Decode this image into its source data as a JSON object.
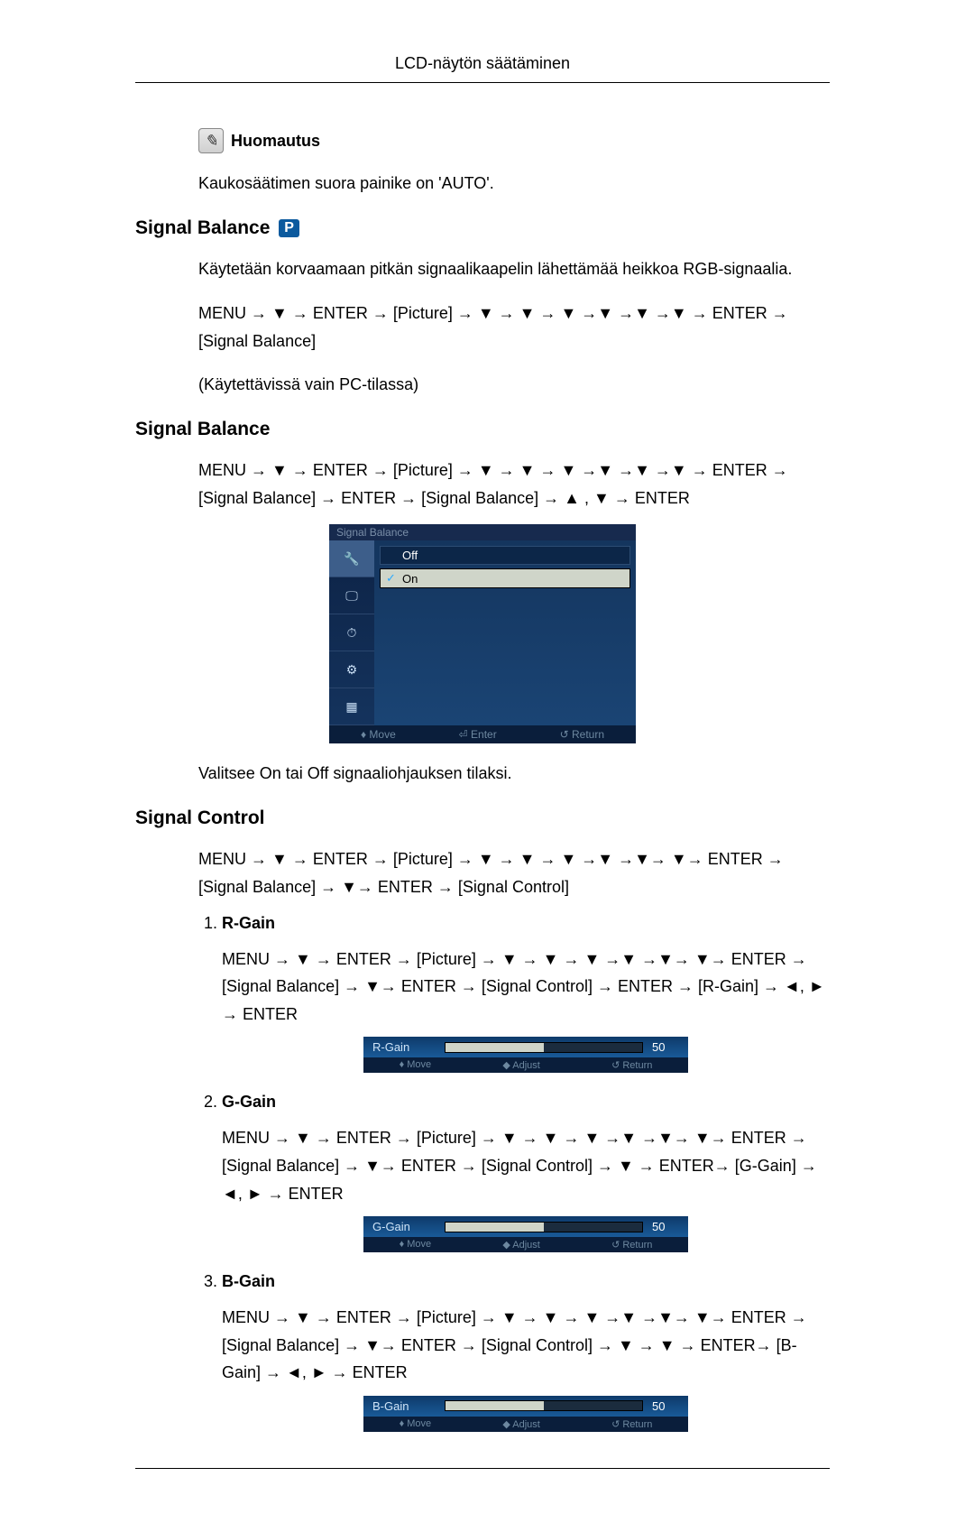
{
  "header": {
    "title": "LCD-näytön säätäminen"
  },
  "note": {
    "label": "Huomautus",
    "text": "Kaukosäätimen suora painike on 'AUTO'."
  },
  "section1": {
    "title": "Signal Balance",
    "badge": "P",
    "intro": "Käytetään korvaamaan pitkän signaalikaapelin lähettämää heikkoa RGB-signaalia.",
    "path": "MENU → ▼ → ENTER → [Picture] → ▼ → ▼ → ▼ →▼ →▼ →▼ → ENTER → [Signal Balance]",
    "availability": "(Käytettävissä vain PC-tilassa)"
  },
  "section2": {
    "title": "Signal Balance",
    "path": "MENU → ▼ → ENTER → [Picture] → ▼ → ▼ → ▼ →▼ →▼ →▼ → ENTER → [Signal Balance] → ENTER → [Signal Balance] → ▲ , ▼ → ENTER",
    "osd": {
      "title": "Signal Balance",
      "options": [
        {
          "label": "Off",
          "selected": false,
          "checked": false
        },
        {
          "label": "On",
          "selected": true,
          "checked": true
        }
      ],
      "footer": {
        "move": "♦ Move",
        "enter": "⏎ Enter",
        "return": "↺ Return"
      }
    },
    "description": "Valitsee On tai Off signaaliohjauksen tilaksi."
  },
  "section3": {
    "title": "Signal Control",
    "path": "MENU → ▼ → ENTER → [Picture] → ▼ → ▼ → ▼ →▼ →▼→ ▼→ ENTER → [Signal Balance] → ▼→ ENTER → [Signal Control]",
    "items": [
      {
        "title": "R-Gain",
        "path": "MENU → ▼ → ENTER → [Picture] → ▼ → ▼ → ▼ →▼ →▼→ ▼→ ENTER → [Signal Balance] → ▼→ ENTER → [Signal Control] → ENTER → [R-Gain] → ◄, ► → ENTER",
        "osd": {
          "label": "R-Gain",
          "value": "50",
          "footer": {
            "move": "♦ Move",
            "adjust": "◆ Adjust",
            "return": "↺ Return"
          }
        }
      },
      {
        "title": "G-Gain",
        "path": "MENU → ▼ → ENTER → [Picture] → ▼ → ▼ → ▼ →▼ →▼→ ▼→ ENTER → [Signal Balance] → ▼→ ENTER → [Signal Control] → ▼ → ENTER→ [G-Gain] → ◄, ► → ENTER",
        "osd": {
          "label": "G-Gain",
          "value": "50",
          "footer": {
            "move": "♦ Move",
            "adjust": "◆ Adjust",
            "return": "↺ Return"
          }
        }
      },
      {
        "title": "B-Gain",
        "path": "MENU → ▼ → ENTER → [Picture] → ▼ → ▼ → ▼ →▼ →▼→ ▼→ ENTER → [Signal Balance] → ▼→ ENTER → [Signal Control] → ▼ → ▼ → ENTER→ [B-Gain] → ◄, ► → ENTER",
        "osd": {
          "label": "B-Gain",
          "value": "50",
          "footer": {
            "move": "♦ Move",
            "adjust": "◆ Adjust",
            "return": "↺ Return"
          }
        }
      }
    ]
  }
}
